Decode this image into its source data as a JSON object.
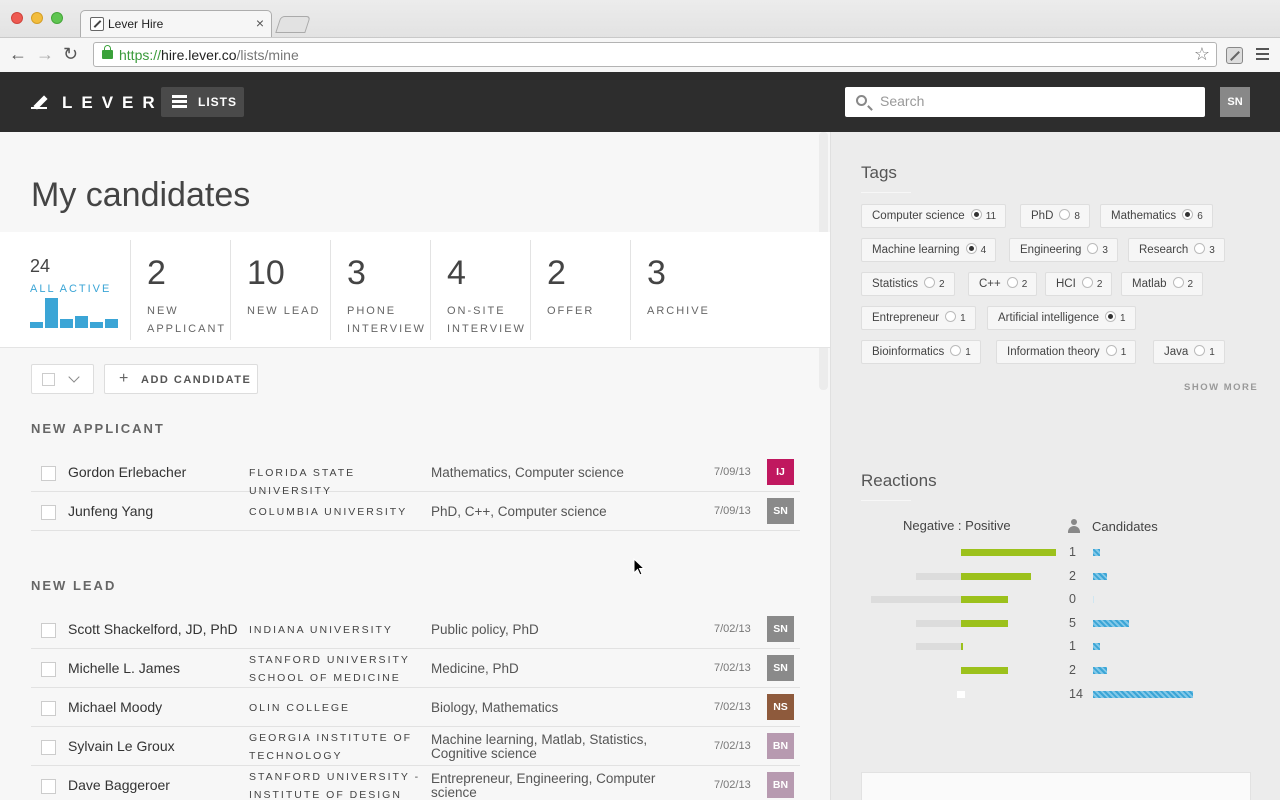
{
  "browser": {
    "tab_title": "Lever Hire",
    "url_scheme": "https://",
    "url_host": "hire.lever.co",
    "url_path": "/lists/mine",
    "tab_close": "×"
  },
  "header": {
    "logo": "LEVER",
    "lists_label": "LISTS",
    "search_placeholder": "Search",
    "user_initials": "SN"
  },
  "page": {
    "title": "My candidates"
  },
  "stages": [
    {
      "count": "24",
      "label": "ALL ACTIVE"
    },
    {
      "count": "2",
      "label": "NEW APPLICANT"
    },
    {
      "count": "10",
      "label": "NEW LEAD"
    },
    {
      "count": "3",
      "label": "PHONE INTERVIEW"
    },
    {
      "count": "4",
      "label": "ON-SITE INTERVIEW"
    },
    {
      "count": "2",
      "label": "OFFER"
    },
    {
      "count": "3",
      "label": "ARCHIVE"
    }
  ],
  "stage_distribution": [
    2,
    10,
    3,
    4,
    2,
    3
  ],
  "actions": {
    "add_candidate": "ADD CANDIDATE"
  },
  "sections": [
    {
      "title": "NEW APPLICANT",
      "rows": [
        {
          "name": "Gordon Erlebacher",
          "school": "FLORIDA STATE UNIVERSITY",
          "tags": "Mathematics, Computer science",
          "date": "7/09/13",
          "owner": "IJ",
          "owner_color": "#c0185f"
        },
        {
          "name": "Junfeng Yang",
          "school": "COLUMBIA UNIVERSITY",
          "tags": "PhD, C++, Computer science",
          "date": "7/09/13",
          "owner": "SN",
          "owner_color": "#8a8a8a"
        }
      ]
    },
    {
      "title": "NEW LEAD",
      "rows": [
        {
          "name": "Scott Shackelford, JD, PhD",
          "school": "INDIANA UNIVERSITY",
          "tags": "Public policy, PhD",
          "date": "7/02/13",
          "owner": "SN",
          "owner_color": "#8a8a8a"
        },
        {
          "name": "Michelle L. James",
          "school": "STANFORD UNIVERSITY SCHOOL OF MEDICINE",
          "tags": "Medicine, PhD",
          "date": "7/02/13",
          "owner": "SN",
          "owner_color": "#8a8a8a"
        },
        {
          "name": "Michael Moody",
          "school": "OLIN COLLEGE",
          "tags": "Biology, Mathematics",
          "date": "7/02/13",
          "owner": "NS",
          "owner_color": "#8e5a3c"
        },
        {
          "name": "Sylvain Le Groux",
          "school": "GEORGIA INSTITUTE OF TECHNOLOGY",
          "tags": "Machine learning, Matlab, Statistics, Cognitive science",
          "date": "7/02/13",
          "owner": "BN",
          "owner_color": "#b79ab0"
        },
        {
          "name": "Dave Baggeroer",
          "school": "STANFORD UNIVERSITY - INSTITUTE OF DESIGN",
          "tags": "Entrepreneur, Engineering, Computer science",
          "date": "7/02/13",
          "owner": "BN",
          "owner_color": "#b79ab0"
        }
      ]
    }
  ],
  "tags_panel": {
    "title": "Tags",
    "show_more": "SHOW MORE",
    "tags": [
      {
        "label": "Computer science",
        "count": "11",
        "selected": true
      },
      {
        "label": "PhD",
        "count": "8",
        "selected": false
      },
      {
        "label": "Mathematics",
        "count": "6",
        "selected": true
      },
      {
        "label": "Machine learning",
        "count": "4",
        "selected": true
      },
      {
        "label": "Engineering",
        "count": "3",
        "selected": false
      },
      {
        "label": "Research",
        "count": "3",
        "selected": false
      },
      {
        "label": "Statistics",
        "count": "2",
        "selected": false
      },
      {
        "label": "C++",
        "count": "2",
        "selected": false
      },
      {
        "label": "HCI",
        "count": "2",
        "selected": false
      },
      {
        "label": "Matlab",
        "count": "2",
        "selected": false
      },
      {
        "label": "Entrepreneur",
        "count": "1",
        "selected": false
      },
      {
        "label": "Artificial intelligence",
        "count": "1",
        "selected": true
      },
      {
        "label": "Bioinformatics",
        "count": "1",
        "selected": false
      },
      {
        "label": "Information theory",
        "count": "1",
        "selected": false
      },
      {
        "label": "Java",
        "count": "1",
        "selected": false
      }
    ]
  },
  "reactions": {
    "title": "Reactions",
    "ratio_header": "Negative : Positive",
    "candidates_header": "Candidates",
    "rows": [
      {
        "negative": 0,
        "positive": 95,
        "candidates": "1"
      },
      {
        "negative": 45,
        "positive": 70,
        "candidates": "2"
      },
      {
        "negative": 90,
        "positive": 47,
        "candidates": "0"
      },
      {
        "negative": 45,
        "positive": 47,
        "candidates": "5"
      },
      {
        "negative": 45,
        "positive": 2,
        "candidates": "1"
      },
      {
        "negative": 0,
        "positive": 47,
        "candidates": "2"
      },
      {
        "negative": 0,
        "positive": 0,
        "candidates": "14"
      }
    ]
  },
  "colors": {
    "accent": "#3ba5d6",
    "positive": "#9cc11c",
    "negative": "#dcdcdc",
    "appbar": "#2d2d2d"
  }
}
